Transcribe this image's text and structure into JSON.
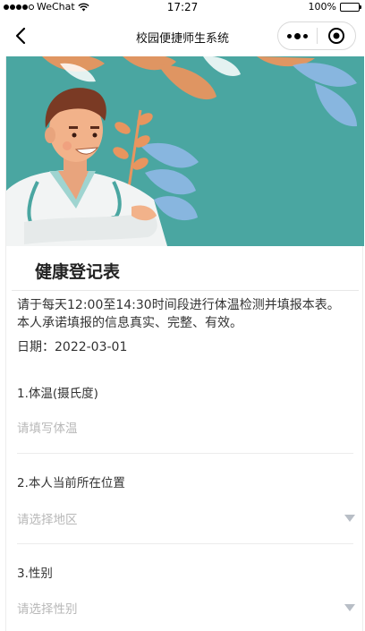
{
  "status_bar": {
    "carrier": "WeChat",
    "time": "17:27",
    "battery": "100%",
    "signal_icon": "signal-dots-icon",
    "wifi_icon": "wifi-icon",
    "battery_icon": "battery-icon",
    "battery_level": 1.0
  },
  "nav": {
    "title": "校园便捷师生系统",
    "back_icon": "chevron-left-icon",
    "more_icon": "more-dots-icon",
    "close_icon": "target-circle-icon"
  },
  "banner": {
    "illustration": "doctor-illustration",
    "colors": {
      "background": "#4aa6a1",
      "leaves_orange": "#e8955f",
      "leaves_blue": "#8fb8e6"
    }
  },
  "form": {
    "title": "健康登记表",
    "notice_line1": "请于每天12:00至14:30时间段进行体温检测并填报本表。",
    "notice_line2": "本人承诺填报的信息真实、完整、有效。",
    "date_label": "日期：",
    "date_value": "2022-03-01",
    "questions": [
      {
        "label": "1.体温(摄氏度)",
        "placeholder": "请填写体温",
        "type": "input"
      },
      {
        "label": "2.本人当前所在位置",
        "placeholder": "请选择地区",
        "type": "select"
      },
      {
        "label": "3.性别",
        "placeholder": "请选择性别",
        "type": "select"
      }
    ]
  }
}
